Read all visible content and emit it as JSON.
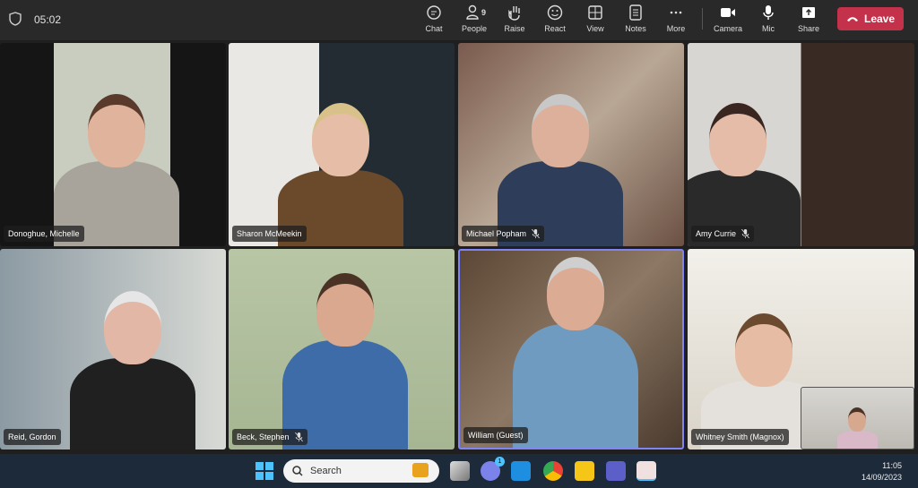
{
  "topbar": {
    "timer": "05:02",
    "buttons": [
      {
        "label": "Chat",
        "icon": "chat-icon"
      },
      {
        "label": "People",
        "icon": "people-icon",
        "count": "9"
      },
      {
        "label": "Raise",
        "icon": "hand-icon"
      },
      {
        "label": "React",
        "icon": "smile-icon"
      },
      {
        "label": "View",
        "icon": "grid-icon"
      },
      {
        "label": "Notes",
        "icon": "notes-icon"
      },
      {
        "label": "More",
        "icon": "more-icon"
      },
      {
        "label": "Camera",
        "icon": "camera-icon"
      },
      {
        "label": "Mic",
        "icon": "mic-icon"
      },
      {
        "label": "Share",
        "icon": "share-icon"
      }
    ],
    "leave": "Leave",
    "leave_color": "#c4314b"
  },
  "participants": [
    {
      "name": "Donoghue, Michelle",
      "muted": false
    },
    {
      "name": "Sharon McMeekin",
      "muted": false
    },
    {
      "name": "Michael Popham",
      "muted": true
    },
    {
      "name": "Amy Currie",
      "muted": true
    },
    {
      "name": "Reid, Gordon",
      "muted": false
    },
    {
      "name": "Beck, Stephen",
      "muted": true
    },
    {
      "name": "William (Guest)",
      "muted": false,
      "speaking": true
    },
    {
      "name": "Whitney Smith (Magnox)",
      "muted": false
    }
  ],
  "taskbar": {
    "search_placeholder": "Search",
    "time": "11:05",
    "date": "14/09/2023",
    "teams_badge": "1"
  }
}
